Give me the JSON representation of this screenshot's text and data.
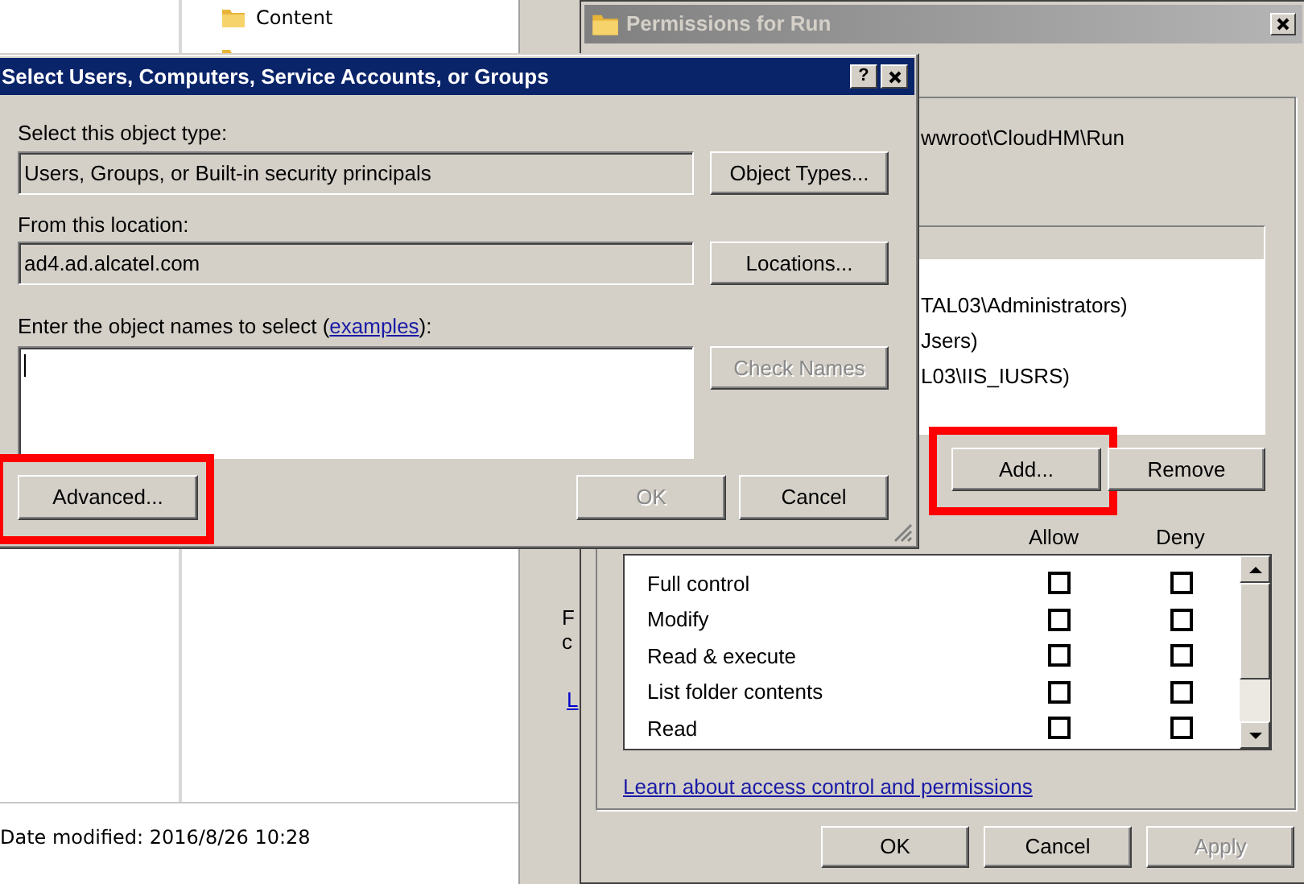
{
  "explorer": {
    "items": [
      {
        "name": "Content"
      }
    ],
    "status": "Date modified: 2016/8/26 10:28"
  },
  "properties_window": {
    "texts": [
      "F",
      "c"
    ],
    "link": "L"
  },
  "permissions_window": {
    "title": "Permissions for Run",
    "object_name": "wwroot\\CloudHM\\Run",
    "users": [
      {
        "name": "TAL03\\Administrators)",
        "selected": false
      },
      {
        "name": "Jsers)",
        "selected": false
      },
      {
        "name": "L03\\IIS_IUSRS)",
        "selected": false
      }
    ],
    "buttons": [
      {
        "label": "Add...",
        "disabled": false,
        "highlighted": true
      },
      {
        "label": "Remove",
        "disabled": false,
        "highlighted": false
      }
    ],
    "columns": [
      "Allow",
      "Deny"
    ],
    "permissions": [
      {
        "name": "Full control",
        "allow": false,
        "deny": false
      },
      {
        "name": "Modify",
        "allow": false,
        "deny": false
      },
      {
        "name": "Read & execute",
        "allow": false,
        "deny": false
      },
      {
        "name": "List folder contents",
        "allow": false,
        "deny": false
      },
      {
        "name": "Read",
        "allow": false,
        "deny": false
      }
    ],
    "link": "Learn about access control and permissions",
    "footer_buttons": [
      {
        "label": "OK",
        "disabled": false
      },
      {
        "label": "Cancel",
        "disabled": false
      },
      {
        "label": "Apply",
        "disabled": true
      }
    ]
  },
  "select_dialog": {
    "title": "Select Users, Computers, Service Accounts, or Groups",
    "help_button": "?",
    "object_type": {
      "label": "Select this object type:",
      "value": "Users, Groups, or Built-in security principals"
    },
    "location": {
      "label": "From this location:",
      "value": "ad4.ad.alcatel.com"
    },
    "names": {
      "label_before": "Enter the object names to select (",
      "link": "examples",
      "label_after": "):"
    },
    "side_buttons": [
      {
        "label": "Object Types...",
        "disabled": false
      },
      {
        "label": "Locations...",
        "disabled": false
      },
      {
        "label": "Check Names",
        "disabled": true
      }
    ],
    "bottom_buttons": [
      {
        "label": "Advanced...",
        "disabled": false,
        "highlighted": true
      },
      {
        "label": "OK",
        "disabled": true,
        "highlighted": false
      },
      {
        "label": "Cancel",
        "disabled": false,
        "highlighted": false
      }
    ]
  }
}
